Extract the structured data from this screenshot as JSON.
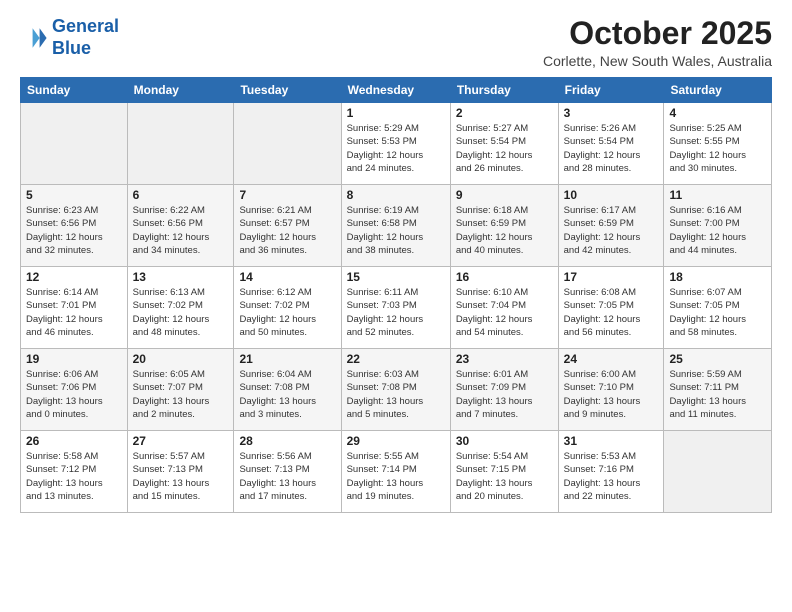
{
  "logo": {
    "line1": "General",
    "line2": "Blue"
  },
  "title": "October 2025",
  "subtitle": "Corlette, New South Wales, Australia",
  "weekdays": [
    "Sunday",
    "Monday",
    "Tuesday",
    "Wednesday",
    "Thursday",
    "Friday",
    "Saturday"
  ],
  "weeks": [
    [
      {
        "day": "",
        "info": ""
      },
      {
        "day": "",
        "info": ""
      },
      {
        "day": "",
        "info": ""
      },
      {
        "day": "1",
        "info": "Sunrise: 5:29 AM\nSunset: 5:53 PM\nDaylight: 12 hours\nand 24 minutes."
      },
      {
        "day": "2",
        "info": "Sunrise: 5:27 AM\nSunset: 5:54 PM\nDaylight: 12 hours\nand 26 minutes."
      },
      {
        "day": "3",
        "info": "Sunrise: 5:26 AM\nSunset: 5:54 PM\nDaylight: 12 hours\nand 28 minutes."
      },
      {
        "day": "4",
        "info": "Sunrise: 5:25 AM\nSunset: 5:55 PM\nDaylight: 12 hours\nand 30 minutes."
      }
    ],
    [
      {
        "day": "5",
        "info": "Sunrise: 6:23 AM\nSunset: 6:56 PM\nDaylight: 12 hours\nand 32 minutes."
      },
      {
        "day": "6",
        "info": "Sunrise: 6:22 AM\nSunset: 6:56 PM\nDaylight: 12 hours\nand 34 minutes."
      },
      {
        "day": "7",
        "info": "Sunrise: 6:21 AM\nSunset: 6:57 PM\nDaylight: 12 hours\nand 36 minutes."
      },
      {
        "day": "8",
        "info": "Sunrise: 6:19 AM\nSunset: 6:58 PM\nDaylight: 12 hours\nand 38 minutes."
      },
      {
        "day": "9",
        "info": "Sunrise: 6:18 AM\nSunset: 6:59 PM\nDaylight: 12 hours\nand 40 minutes."
      },
      {
        "day": "10",
        "info": "Sunrise: 6:17 AM\nSunset: 6:59 PM\nDaylight: 12 hours\nand 42 minutes."
      },
      {
        "day": "11",
        "info": "Sunrise: 6:16 AM\nSunset: 7:00 PM\nDaylight: 12 hours\nand 44 minutes."
      }
    ],
    [
      {
        "day": "12",
        "info": "Sunrise: 6:14 AM\nSunset: 7:01 PM\nDaylight: 12 hours\nand 46 minutes."
      },
      {
        "day": "13",
        "info": "Sunrise: 6:13 AM\nSunset: 7:02 PM\nDaylight: 12 hours\nand 48 minutes."
      },
      {
        "day": "14",
        "info": "Sunrise: 6:12 AM\nSunset: 7:02 PM\nDaylight: 12 hours\nand 50 minutes."
      },
      {
        "day": "15",
        "info": "Sunrise: 6:11 AM\nSunset: 7:03 PM\nDaylight: 12 hours\nand 52 minutes."
      },
      {
        "day": "16",
        "info": "Sunrise: 6:10 AM\nSunset: 7:04 PM\nDaylight: 12 hours\nand 54 minutes."
      },
      {
        "day": "17",
        "info": "Sunrise: 6:08 AM\nSunset: 7:05 PM\nDaylight: 12 hours\nand 56 minutes."
      },
      {
        "day": "18",
        "info": "Sunrise: 6:07 AM\nSunset: 7:05 PM\nDaylight: 12 hours\nand 58 minutes."
      }
    ],
    [
      {
        "day": "19",
        "info": "Sunrise: 6:06 AM\nSunset: 7:06 PM\nDaylight: 13 hours\nand 0 minutes."
      },
      {
        "day": "20",
        "info": "Sunrise: 6:05 AM\nSunset: 7:07 PM\nDaylight: 13 hours\nand 2 minutes."
      },
      {
        "day": "21",
        "info": "Sunrise: 6:04 AM\nSunset: 7:08 PM\nDaylight: 13 hours\nand 3 minutes."
      },
      {
        "day": "22",
        "info": "Sunrise: 6:03 AM\nSunset: 7:08 PM\nDaylight: 13 hours\nand 5 minutes."
      },
      {
        "day": "23",
        "info": "Sunrise: 6:01 AM\nSunset: 7:09 PM\nDaylight: 13 hours\nand 7 minutes."
      },
      {
        "day": "24",
        "info": "Sunrise: 6:00 AM\nSunset: 7:10 PM\nDaylight: 13 hours\nand 9 minutes."
      },
      {
        "day": "25",
        "info": "Sunrise: 5:59 AM\nSunset: 7:11 PM\nDaylight: 13 hours\nand 11 minutes."
      }
    ],
    [
      {
        "day": "26",
        "info": "Sunrise: 5:58 AM\nSunset: 7:12 PM\nDaylight: 13 hours\nand 13 minutes."
      },
      {
        "day": "27",
        "info": "Sunrise: 5:57 AM\nSunset: 7:13 PM\nDaylight: 13 hours\nand 15 minutes."
      },
      {
        "day": "28",
        "info": "Sunrise: 5:56 AM\nSunset: 7:13 PM\nDaylight: 13 hours\nand 17 minutes."
      },
      {
        "day": "29",
        "info": "Sunrise: 5:55 AM\nSunset: 7:14 PM\nDaylight: 13 hours\nand 19 minutes."
      },
      {
        "day": "30",
        "info": "Sunrise: 5:54 AM\nSunset: 7:15 PM\nDaylight: 13 hours\nand 20 minutes."
      },
      {
        "day": "31",
        "info": "Sunrise: 5:53 AM\nSunset: 7:16 PM\nDaylight: 13 hours\nand 22 minutes."
      },
      {
        "day": "",
        "info": ""
      }
    ]
  ]
}
